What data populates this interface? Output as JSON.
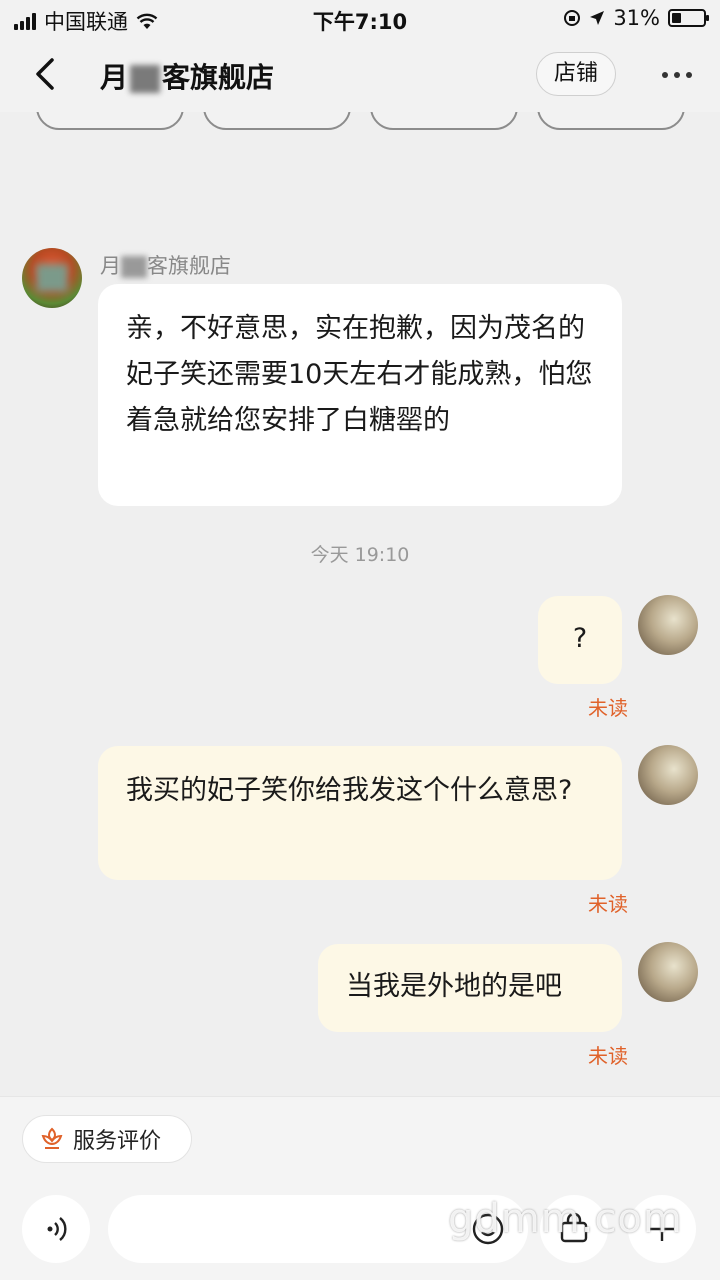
{
  "status_bar": {
    "carrier": "中国联通",
    "time": "下午7:10",
    "battery": "31%"
  },
  "nav": {
    "title_start": "月",
    "title_end": "客旗舰店",
    "shop_button": "店铺"
  },
  "conversation": {
    "sender_name_start": "月",
    "sender_name_end": "客旗舰店",
    "seller_message": "亲，不好意思，实在抱歉，因为茂名的妃子笑还需要10天左右才能成熟，怕您着急就给您安排了白糖罂的",
    "timestamp": "今天 19:10",
    "my_messages": [
      {
        "text": "?",
        "status": "未读"
      },
      {
        "text": "我买的妃子笑你给我发这个什么意思?",
        "status": "未读"
      },
      {
        "text": "当我是外地的是吧",
        "status": "未读"
      }
    ]
  },
  "bottom": {
    "service_label": "服务评价",
    "watermark": "gdmm.com"
  }
}
